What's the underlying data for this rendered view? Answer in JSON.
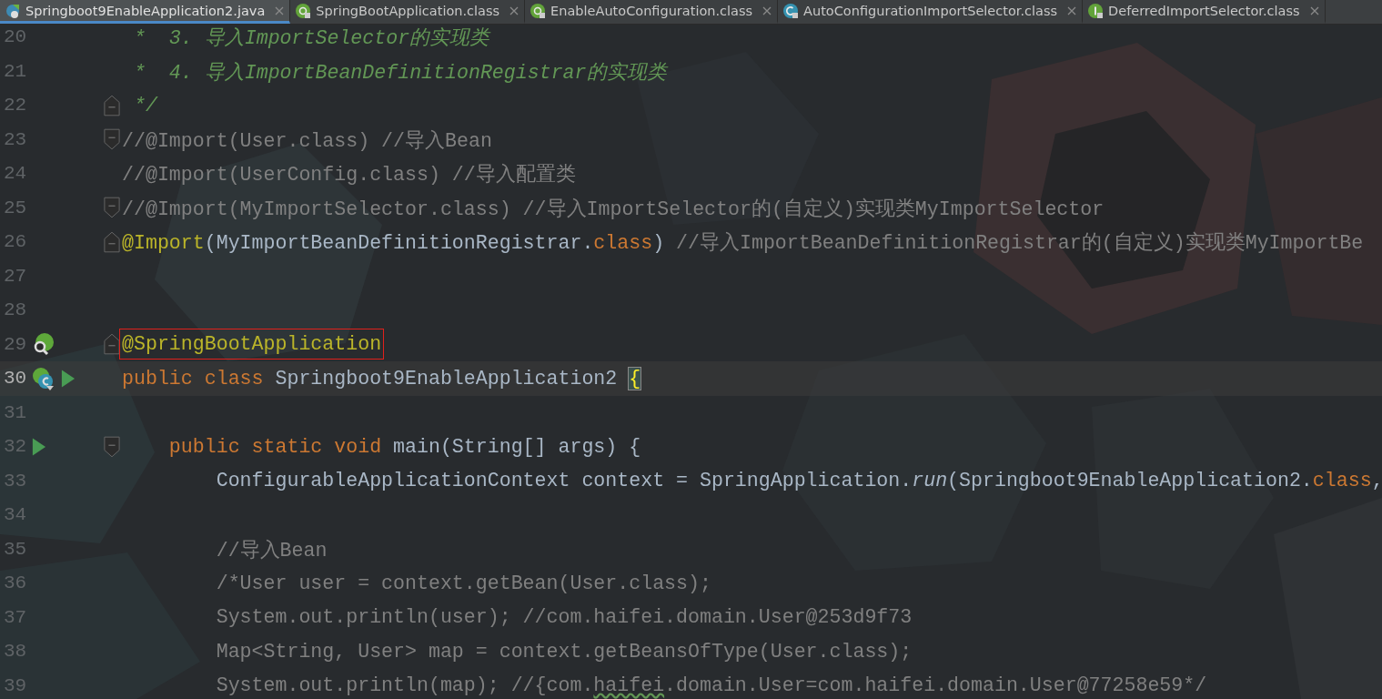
{
  "tabs": [
    {
      "label": "Springboot9EnableApplication2.java",
      "selected": true,
      "kind": "boot"
    },
    {
      "label": "SpringBootApplication.class",
      "selected": false,
      "kind": "annotation"
    },
    {
      "label": "EnableAutoConfiguration.class",
      "selected": false,
      "kind": "annotation"
    },
    {
      "label": "AutoConfigurationImportSelector.class",
      "selected": false,
      "kind": "class"
    },
    {
      "label": "DeferredImportSelector.class",
      "selected": false,
      "kind": "interface"
    }
  ],
  "lines": [
    {
      "number": "20",
      "segments": [
        {
          "text": " *  3. 导入ImportSelector的实现类",
          "kind": "doc"
        }
      ]
    },
    {
      "number": "21",
      "segments": [
        {
          "text": " *  4. 导入ImportBeanDefinitionRegistrar的实现类",
          "kind": "doc"
        }
      ]
    },
    {
      "number": "22",
      "fold_marker": {
        "kind": "end"
      },
      "segments": [
        {
          "text": " */",
          "kind": "doc"
        }
      ]
    },
    {
      "number": "23",
      "fold_marker": {
        "kind": "start"
      },
      "segments": [
        {
          "text": "//@Import(User.class) //导入Bean",
          "kind": "comment"
        }
      ]
    },
    {
      "number": "24",
      "segments": [
        {
          "text": "//@Import(UserConfig.class) //导入配置类",
          "kind": "comment"
        }
      ]
    },
    {
      "number": "25",
      "fold_marker": {
        "kind": "start"
      },
      "segments": [
        {
          "text": "//@Import(MyImportSelector.class) //导入ImportSelector的(自定义)实现类MyImportSelector",
          "kind": "comment"
        }
      ]
    },
    {
      "number": "26",
      "fold_marker": {
        "kind": "end"
      },
      "segments": [
        {
          "text": "@Import",
          "kind": "annotation"
        },
        {
          "text": "(MyImportBeanDefinitionRegistrar.",
          "kind": "plain"
        },
        {
          "text": "class",
          "kind": "keyword"
        },
        {
          "text": ") ",
          "kind": "plain"
        },
        {
          "text": "//导入ImportBeanDefinitionRegistrar的(自定义)实现类MyImportBe",
          "kind": "comment"
        }
      ]
    },
    {
      "number": "27"
    },
    {
      "number": "28"
    },
    {
      "number": "29",
      "fold_marker": {
        "kind": "end"
      },
      "gutter_icons": [
        {
          "kind": "bean-search"
        }
      ],
      "segments": [
        {
          "text": "@SpringBootApplication",
          "kind": "annotation",
          "boxed": true
        }
      ]
    },
    {
      "number": "30",
      "current": true,
      "gutter_icons": [
        {
          "kind": "bean-class"
        },
        {
          "kind": "run"
        }
      ],
      "segments": [
        {
          "text": "public class",
          "kind": "keyword"
        },
        {
          "text": " Springboot9EnableApplication2 ",
          "kind": "plain"
        },
        {
          "text": "{",
          "kind": "matched"
        }
      ]
    },
    {
      "number": "31"
    },
    {
      "number": "32",
      "fold_marker": {
        "kind": "start"
      },
      "gutter_icons": [
        {
          "kind": "run"
        }
      ],
      "segments": [
        {
          "text": "    public static void",
          "kind": "keyword"
        },
        {
          "text": " main(String[] args) {",
          "kind": "plain"
        }
      ]
    },
    {
      "number": "33",
      "segments": [
        {
          "text": "        ConfigurableApplicationContext context = SpringApplication.",
          "kind": "plain"
        },
        {
          "text": "run",
          "kind": "static-call"
        },
        {
          "text": "(Springboot9EnableApplication2.",
          "kind": "plain"
        },
        {
          "text": "class",
          "kind": "keyword"
        },
        {
          "text": ",",
          "kind": "plain"
        }
      ]
    },
    {
      "number": "34"
    },
    {
      "number": "35",
      "segments": [
        {
          "text": "        //导入Bean",
          "kind": "comment"
        }
      ]
    },
    {
      "number": "36",
      "segments": [
        {
          "text": "        /*User user = context.getBean(User.class);",
          "kind": "comment"
        }
      ]
    },
    {
      "number": "37",
      "segments": [
        {
          "text": "        System.out.println(user); //com.haifei.domain.User@253d9f73",
          "kind": "comment"
        }
      ]
    },
    {
      "number": "38",
      "segments": [
        {
          "text": "        Map<String, User> map = context.getBeansOfType(User.class);",
          "kind": "comment"
        }
      ]
    },
    {
      "number": "39",
      "segments": [
        {
          "text": "        System.out.println(map); //{com.",
          "kind": "comment"
        },
        {
          "text": "haifei",
          "kind": "typo"
        },
        {
          "text": ".domain.User=com.haifei.domain.User@77258e59*/",
          "kind": "comment"
        }
      ]
    }
  ]
}
